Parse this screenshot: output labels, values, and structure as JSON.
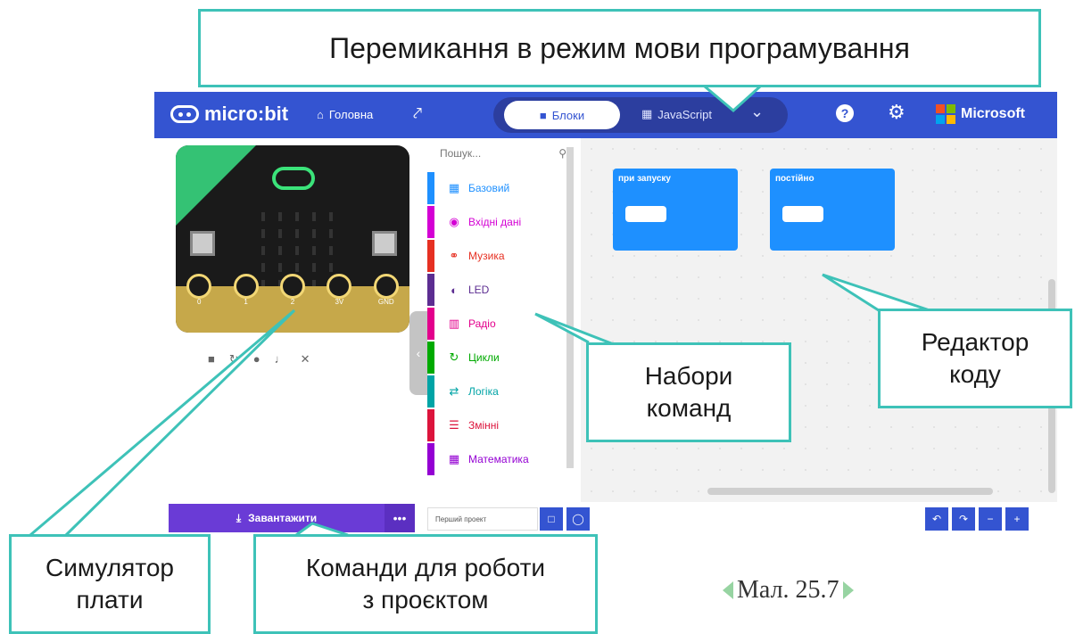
{
  "header": {
    "logo": "micro:bit",
    "home_label": "Головна",
    "blocks_label": "Блоки",
    "js_label": "JavaScript",
    "brand": "Microsoft"
  },
  "simulator": {
    "pins": [
      "0",
      "1",
      "2",
      "3V",
      "GND"
    ],
    "download_label": "Завантажити",
    "more_label": "•••"
  },
  "toolbox": {
    "search_placeholder": "Пошук...",
    "categories": [
      {
        "label": "Базовий",
        "color": "#1e90ff"
      },
      {
        "label": "Вхідні дані",
        "color": "#d400d4"
      },
      {
        "label": "Музика",
        "color": "#e63022"
      },
      {
        "label": "LED",
        "color": "#5c2d91"
      },
      {
        "label": "Радіо",
        "color": "#e3008c"
      },
      {
        "label": "Цикли",
        "color": "#00aa00"
      },
      {
        "label": "Логіка",
        "color": "#00a4a6"
      },
      {
        "label": "Змінні",
        "color": "#dc143c"
      },
      {
        "label": "Математика",
        "color": "#9400d3"
      }
    ]
  },
  "workspace": {
    "blocks": [
      {
        "label": "при запуску"
      },
      {
        "label": "постійно"
      }
    ]
  },
  "footer": {
    "project_name_placeholder": "Перший проект"
  },
  "callouts": {
    "mode_switch": "Перемикання в режим мови програмування",
    "command_sets": [
      "Набори",
      "команд"
    ],
    "code_editor": [
      "Редактор",
      "коду"
    ],
    "simulator": [
      "Симулятор",
      "плати"
    ],
    "project_commands": [
      "Команди для роботи",
      "з проєктом"
    ]
  },
  "caption": "Мал. 25.7"
}
